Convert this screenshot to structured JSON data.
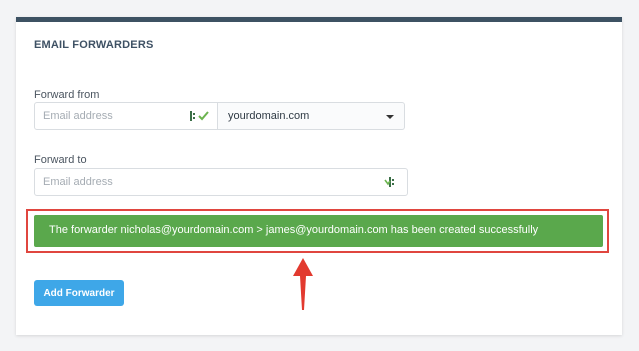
{
  "panel": {
    "title": "EMAIL FORWARDERS"
  },
  "form": {
    "forward_from_label": "Forward from",
    "forward_from_placeholder": "Email address",
    "domain_selected": "yourdomain.com",
    "forward_to_label": "Forward to",
    "forward_to_placeholder": "Email address",
    "add_button_label": "Add Forwarder"
  },
  "alert": {
    "message": "The forwarder nicholas@yourdomain.com > james@yourdomain.com has been created successfully",
    "color": "#5aa84c",
    "highlight_color": "#e0463f"
  },
  "icons": {
    "password_manager": "password-manager-icon",
    "arrow": "arrow-up-icon",
    "caret": "chevron-down-icon"
  },
  "colors": {
    "accent_button": "#3ea7e8",
    "panel_top_border": "#3d5263"
  }
}
